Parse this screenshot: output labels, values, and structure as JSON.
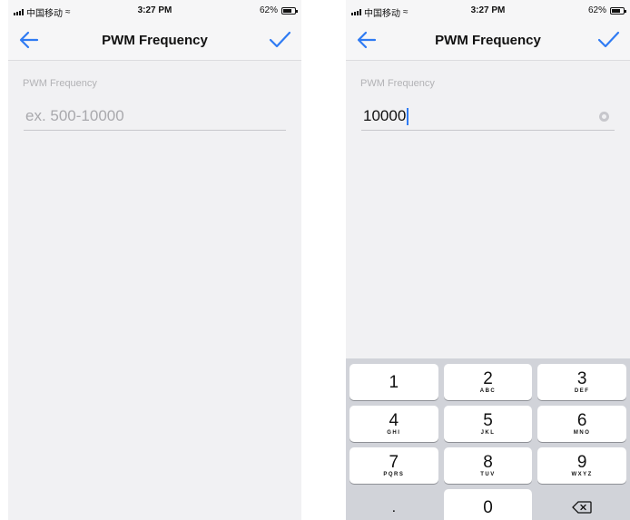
{
  "screens": {
    "empty": {
      "status": {
        "carrier": "中国移动",
        "time": "3:27 PM",
        "battery": "62%"
      },
      "nav": {
        "title": "PWM Frequency",
        "back_icon": "arrow-left-icon",
        "confirm_icon": "checkmark-icon"
      },
      "field": {
        "label": "PWM Frequency",
        "placeholder": "ex. 500-10000",
        "value": ""
      }
    },
    "filled": {
      "status": {
        "carrier": "中国移动",
        "time": "3:27 PM",
        "battery": "62%"
      },
      "nav": {
        "title": "PWM Frequency",
        "back_icon": "arrow-left-icon",
        "confirm_icon": "checkmark-icon"
      },
      "field": {
        "label": "PWM Frequency",
        "placeholder": "ex. 500-10000",
        "value": "10000"
      },
      "keypad": {
        "keys": [
          {
            "num": "1",
            "letters": ""
          },
          {
            "num": "2",
            "letters": "ABC"
          },
          {
            "num": "3",
            "letters": "DEF"
          },
          {
            "num": "4",
            "letters": "GHI"
          },
          {
            "num": "5",
            "letters": "JKL"
          },
          {
            "num": "6",
            "letters": "MNO"
          },
          {
            "num": "7",
            "letters": "PQRS"
          },
          {
            "num": "8",
            "letters": "TUV"
          },
          {
            "num": "9",
            "letters": "WXYZ"
          },
          {
            "num": ".",
            "letters": ""
          },
          {
            "num": "0",
            "letters": ""
          }
        ],
        "delete_icon": "backspace-icon"
      }
    }
  },
  "colors": {
    "accent": "#2f7bf3",
    "background": "#f1f1f3",
    "keyboard": "#d1d3d9"
  }
}
